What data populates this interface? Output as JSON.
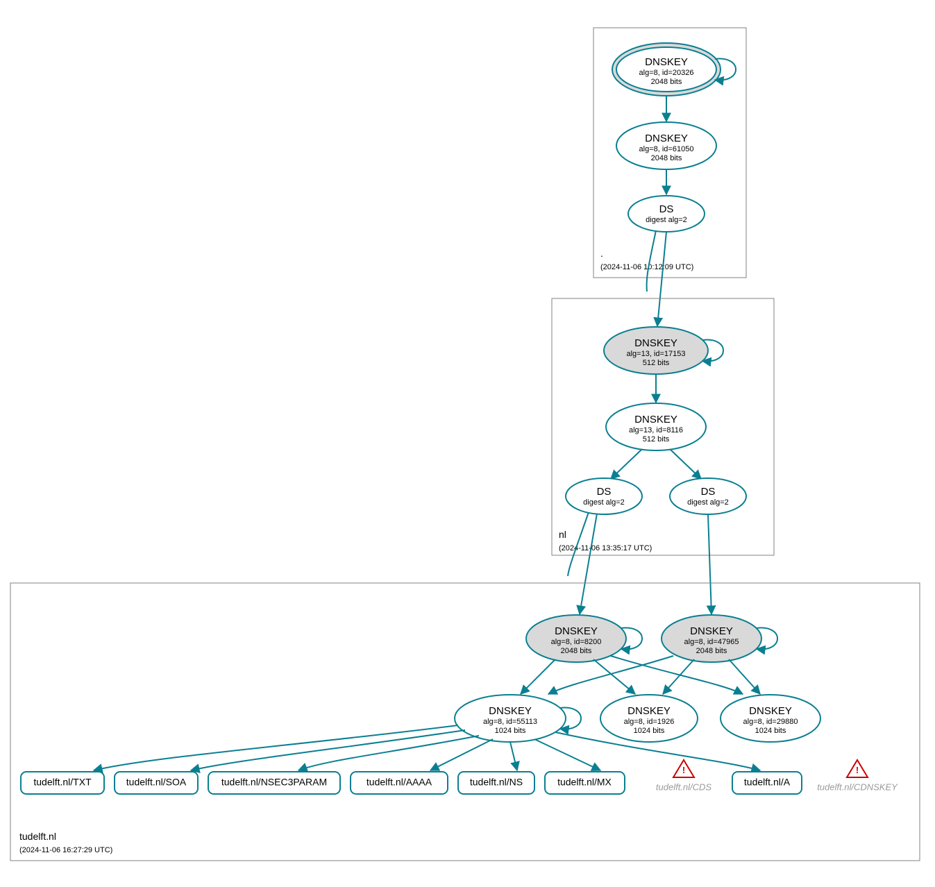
{
  "colors": {
    "stroke": "#0a7f91",
    "ksk_fill": "#d9d9d9",
    "box": "#808080",
    "warn": "#cc0000"
  },
  "zones": {
    "root": {
      "label": ".",
      "timestamp": "(2024-11-06 10:12:09 UTC)",
      "dnskey_ksk": {
        "title": "DNSKEY",
        "line1": "alg=8, id=20326",
        "line2": "2048 bits"
      },
      "dnskey_zsk": {
        "title": "DNSKEY",
        "line1": "alg=8, id=61050",
        "line2": "2048 bits"
      },
      "ds": {
        "title": "DS",
        "line1": "digest alg=2"
      }
    },
    "nl": {
      "label": "nl",
      "timestamp": "(2024-11-06 13:35:17 UTC)",
      "dnskey_ksk": {
        "title": "DNSKEY",
        "line1": "alg=13, id=17153",
        "line2": "512 bits"
      },
      "dnskey_zsk": {
        "title": "DNSKEY",
        "line1": "alg=13, id=8116",
        "line2": "512 bits"
      },
      "ds_a": {
        "title": "DS",
        "line1": "digest alg=2"
      },
      "ds_b": {
        "title": "DS",
        "line1": "digest alg=2"
      }
    },
    "tudelft": {
      "label": "tudelft.nl",
      "timestamp": "(2024-11-06 16:27:29 UTC)",
      "ksk_a": {
        "title": "DNSKEY",
        "line1": "alg=8, id=8200",
        "line2": "2048 bits"
      },
      "ksk_b": {
        "title": "DNSKEY",
        "line1": "alg=8, id=47965",
        "line2": "2048 bits"
      },
      "zsk_a": {
        "title": "DNSKEY",
        "line1": "alg=8, id=55113",
        "line2": "1024 bits"
      },
      "zsk_b": {
        "title": "DNSKEY",
        "line1": "alg=8, id=1926",
        "line2": "1024 bits"
      },
      "zsk_c": {
        "title": "DNSKEY",
        "line1": "alg=8, id=29880",
        "line2": "1024 bits"
      },
      "records": {
        "txt": "tudelft.nl/TXT",
        "soa": "tudelft.nl/SOA",
        "nsec": "tudelft.nl/NSEC3PARAM",
        "aaaa": "tudelft.nl/AAAA",
        "ns": "tudelft.nl/NS",
        "mx": "tudelft.nl/MX",
        "a": "tudelft.nl/A"
      },
      "warnings": {
        "cds": "tudelft.nl/CDS",
        "cdnskey": "tudelft.nl/CDNSKEY"
      }
    }
  }
}
